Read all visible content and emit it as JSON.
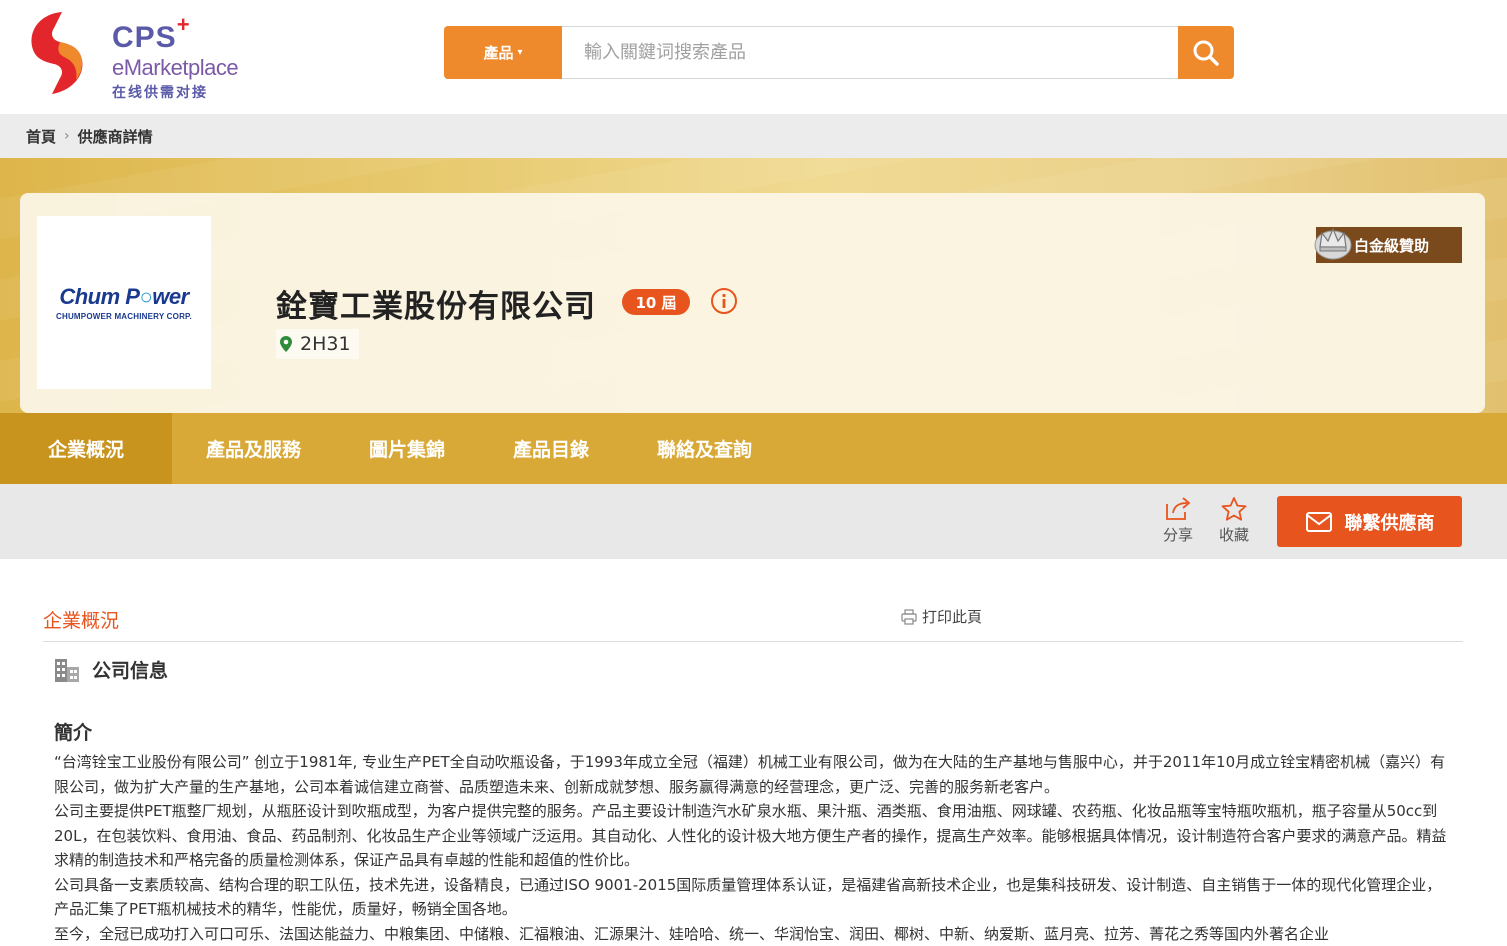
{
  "brand": {
    "logo_cps": "CPS",
    "logo_plus": "+",
    "logo_emarketplace": "eMarketplace",
    "logo_sub": "在线供需对接"
  },
  "search": {
    "category_label": "產品",
    "placeholder": "輸入關鍵词搜索產品"
  },
  "breadcrumb": {
    "home": "首頁",
    "current": "供應商詳情"
  },
  "company": {
    "logo_name_a": "Chum P",
    "logo_name_b": "wer",
    "logo_sub": "CHUMPOWER MACHINERY CORP.",
    "name": "銓寶工業股份有限公司",
    "edition": "10 屆",
    "booth": "2H31",
    "sponsor": "白金級贊助"
  },
  "tabs": [
    {
      "label": "企業概況"
    },
    {
      "label": "產品及服務"
    },
    {
      "label": "圖片集錦"
    },
    {
      "label": "產品目錄"
    },
    {
      "label": "聯絡及查詢"
    }
  ],
  "actions": {
    "share": "分享",
    "favorite": "收藏",
    "contact": "聯繫供應商"
  },
  "content": {
    "section_title": "企業概況",
    "print": "打印此頁",
    "company_info": "公司信息",
    "intro_title": "簡介",
    "paragraphs": [
      "“台湾铨宝工业股份有限公司” 创立于1981年, 专业生产PET全自动吹瓶设备，于1993年成立全冠（福建）机械工业有限公司，做为在大陆的生产基地与售服中心，并于2011年10月成立铨宝精密机械（嘉兴）有限公司，做为扩大产量的生产基地，公司本着诚信建立商誉、品质塑造未来、创新成就梦想、服务赢得满意的经营理念，更广泛、完善的服务新老客户。",
      "公司主要提供PET瓶整厂规划，从瓶胚设计到吹瓶成型，为客户提供完整的服务。产品主要设计制造汽水矿泉水瓶、果汁瓶、酒类瓶、食用油瓶、网球罐、农药瓶、化妆品瓶等宝特瓶吹瓶机，瓶子容量从50cc到20L，在包装饮料、食用油、食品、药品制剂、化妆品生产企业等领域广泛运用。其自动化、人性化的设计极大地方便生产者的操作，提高生产效率。能够根据具体情况，设计制造符合客户要求的满意产品。精益求精的制造技术和严格完备的质量检测体系，保证产品具有卓越的性能和超值的性价比。",
      "公司具备一支素质较高、结构合理的职工队伍，技术先进，设备精良，已通过ISO 9001-2015国际质量管理体系认证，是福建省高新技术企业，也是集科技研发、设计制造、自主销售于一体的现代化管理企业，产品汇集了PET瓶机械技术的精华，性能优，质量好，畅销全国各地。",
      "至今，全冠已成功打入可口可乐、法国达能益力、中粮集团、中储粮、汇福粮油、汇源果汁、娃哈哈、统一、华润怡宝、润田、椰树、中新、纳爱斯、蓝月亮、拉芳、菁花之秀等国内外著名企业"
    ]
  },
  "colors": {
    "orange": "#ee8a2c",
    "accent_red": "#e8541e",
    "gold": "#d9a937",
    "gold_dark": "#c8941e",
    "sponsor_brown": "#7a4a1d"
  }
}
